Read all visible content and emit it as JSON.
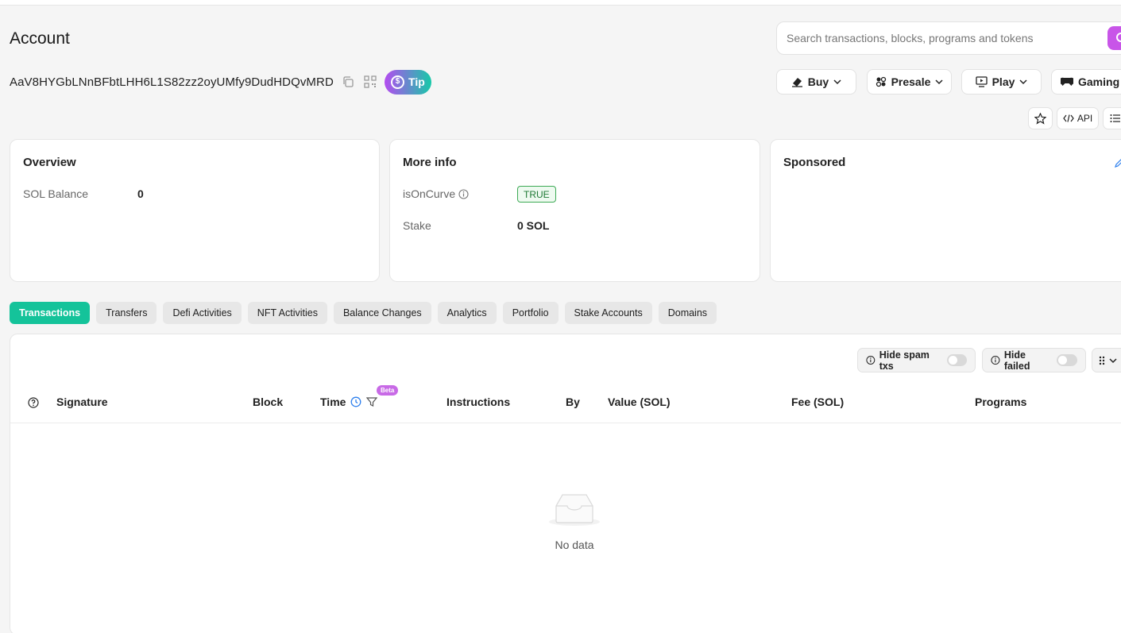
{
  "header": {
    "title": "Account",
    "search_placeholder": "Search transactions, blocks, programs and tokens"
  },
  "account": {
    "address": "AaV8HYGbLNnBFbtLHH6L1S82zz2oyUMfy9DudHDQvMRD",
    "tip_label": "Tip"
  },
  "nav": {
    "buy": "Buy",
    "presale": "Presale",
    "play": "Play",
    "gaming": "Gaming",
    "api": "API"
  },
  "overview": {
    "title": "Overview",
    "sol_balance_label": "SOL Balance",
    "sol_balance_value": "0"
  },
  "more_info": {
    "title": "More info",
    "is_on_curve_label": "isOnCurve",
    "is_on_curve_value": "TRUE",
    "stake_label": "Stake",
    "stake_value": "0 SOL"
  },
  "sponsored": {
    "title": "Sponsored"
  },
  "tabs": [
    {
      "label": "Transactions",
      "active": true
    },
    {
      "label": "Transfers"
    },
    {
      "label": "Defi Activities"
    },
    {
      "label": "NFT Activities"
    },
    {
      "label": "Balance Changes"
    },
    {
      "label": "Analytics"
    },
    {
      "label": "Portfolio"
    },
    {
      "label": "Stake Accounts"
    },
    {
      "label": "Domains"
    }
  ],
  "filters": {
    "hide_spam": "Hide spam txs",
    "hide_failed": "Hide failed"
  },
  "table": {
    "columns": [
      "Signature",
      "Block",
      "Time",
      "Instructions",
      "By",
      "Value (SOL)",
      "Fee (SOL)",
      "Programs"
    ],
    "beta_badge": "Beta",
    "empty_text": "No data"
  },
  "colors": {
    "accent_green": "#14c39a",
    "accent_purple": "#c855e8",
    "true_badge": "#3daa55"
  }
}
